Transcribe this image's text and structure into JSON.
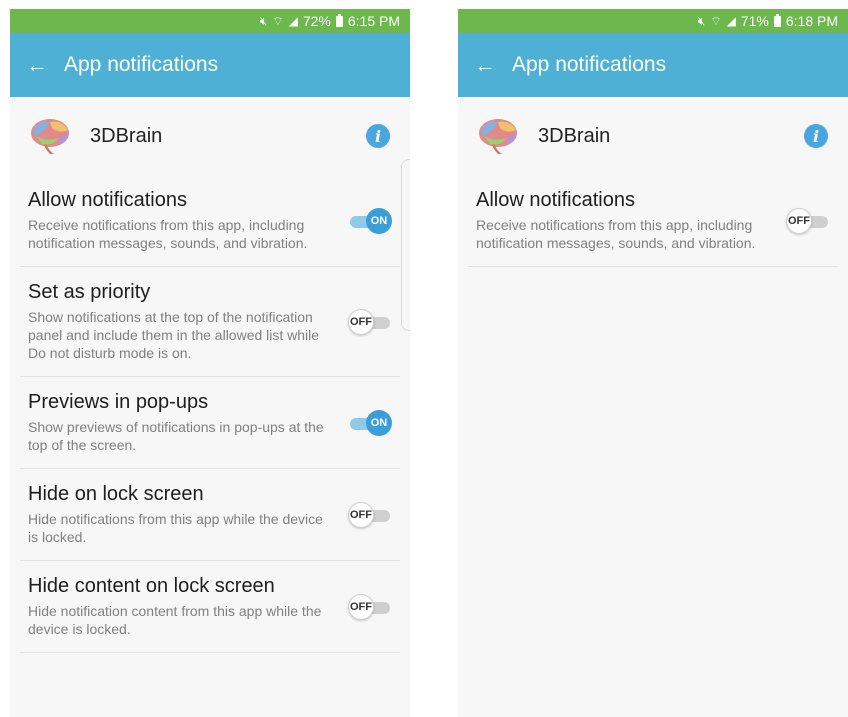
{
  "left": {
    "status": {
      "percent": "72%",
      "time": "6:15 PM"
    },
    "app_bar": {
      "title": "App notifications"
    },
    "app": {
      "name": "3DBrain"
    },
    "settings": [
      {
        "title": "Allow notifications",
        "desc": "Receive notifications from this app, including notification messages, sounds, and vibration.",
        "state": "ON"
      },
      {
        "title": "Set as priority",
        "desc": "Show notifications at the top of the notification panel and include them in the allowed list while Do not disturb mode is on.",
        "state": "OFF"
      },
      {
        "title": "Previews in pop-ups",
        "desc": "Show previews of notifications in pop-ups at the top of the screen.",
        "state": "ON"
      },
      {
        "title": "Hide on lock screen",
        "desc": "Hide notifications from this app while the device is locked.",
        "state": "OFF"
      },
      {
        "title": "Hide content on lock screen",
        "desc": "Hide notification content from this app while the device is locked.",
        "state": "OFF"
      }
    ]
  },
  "right": {
    "status": {
      "percent": "71%",
      "time": "6:18 PM"
    },
    "app_bar": {
      "title": "App notifications"
    },
    "app": {
      "name": "3DBrain"
    },
    "settings": [
      {
        "title": "Allow notifications",
        "desc": "Receive notifications from this app, including notification messages, sounds, and vibration.",
        "state": "OFF"
      }
    ]
  },
  "icons": {
    "back": "back-arrow-icon",
    "info": "info-icon",
    "battery": "battery-icon",
    "signal": "signal-icon",
    "wifi": "wifi-icon",
    "mute": "mute-icon"
  },
  "colors": {
    "status_bar": "#6cb84d",
    "app_bar": "#4fb0d6",
    "toggle_on": "#3a9fd8",
    "info": "#4aa6e0"
  }
}
